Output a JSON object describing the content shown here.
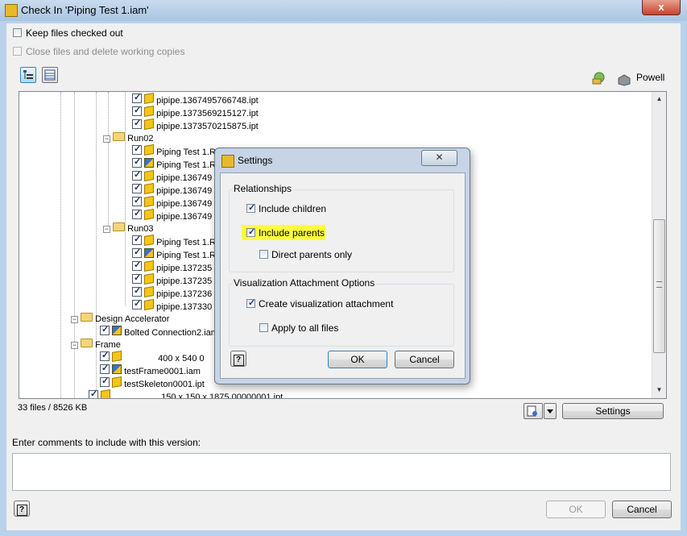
{
  "window": {
    "title": "Check In 'Piping Test 1.iam'",
    "close_label": "x"
  },
  "options": {
    "keep_checked_out": "Keep files checked out",
    "close_files": "Close files and delete working copies"
  },
  "toolbar": {
    "user_name": "Powell"
  },
  "tree": {
    "rows": [
      {
        "label": "pipipe.1367495766748.ipt"
      },
      {
        "label": "pipipe.1373569215127.ipt"
      },
      {
        "label": "pipipe.1373570215875.ipt"
      },
      {
        "label": "Run02"
      },
      {
        "label": "Piping Test 1.R"
      },
      {
        "label": "Piping Test 1.R"
      },
      {
        "label": "pipipe.136749"
      },
      {
        "label": "pipipe.136749"
      },
      {
        "label": "pipipe.136749"
      },
      {
        "label": "pipipe.136749"
      },
      {
        "label": "Run03"
      },
      {
        "label": "Piping Test 1.R"
      },
      {
        "label": "Piping Test 1.R"
      },
      {
        "label": "pipipe.137235"
      },
      {
        "label": "pipipe.137235"
      },
      {
        "label": "pipipe.137236"
      },
      {
        "label": "pipipe.137330"
      },
      {
        "label": "Design Accelerator"
      },
      {
        "label": "Bolted Connection2.iam"
      },
      {
        "label": "Frame"
      },
      {
        "label": "400 x 540 0"
      },
      {
        "label": "testFrame0001.iam"
      },
      {
        "label": "testSkeleton0001.ipt"
      },
      {
        "label": "150 x 150 x 1875.00000001.ipt"
      }
    ]
  },
  "status": {
    "file_summary": "33 files / 8526 KB",
    "settings_button": "Settings"
  },
  "comments": {
    "label": "Enter comments to include with this version:",
    "value": ""
  },
  "footer": {
    "help": "?",
    "ok": "OK",
    "cancel": "Cancel"
  },
  "settings_dialog": {
    "title": "Settings",
    "close_label": "✕",
    "relationships_group": "Relationships",
    "include_children": "Include children",
    "include_parents": "Include parents",
    "direct_parents_only": "Direct parents only",
    "visualization_group": "Visualization Attachment Options",
    "create_visualization": "Create visualization attachment",
    "apply_all_files": "Apply to all files",
    "help": "?",
    "ok": "OK",
    "cancel": "Cancel",
    "highlight_color": "#ffff3a"
  }
}
